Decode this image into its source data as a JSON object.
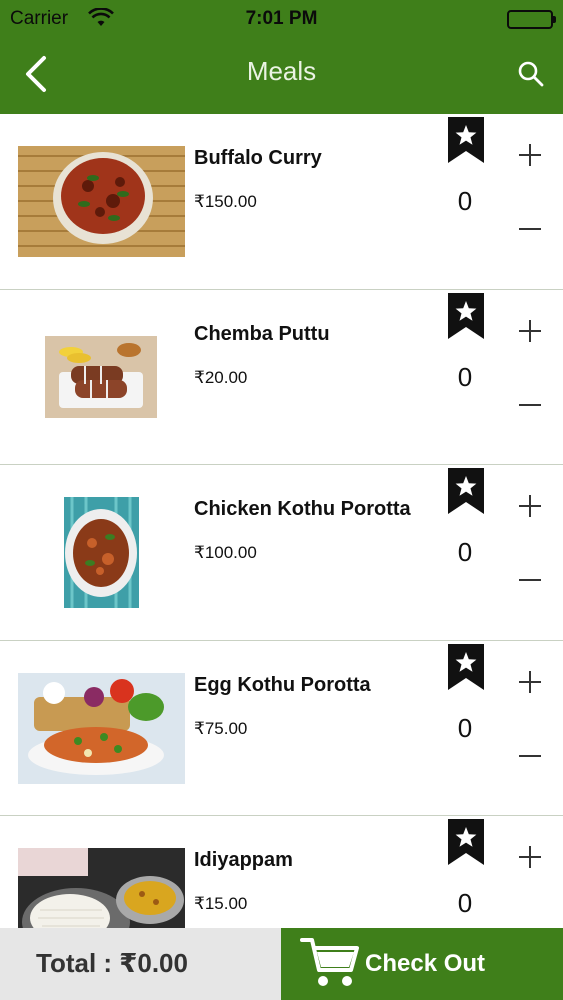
{
  "status_bar": {
    "carrier": "Carrier",
    "time": "7:01 PM"
  },
  "nav": {
    "title": "Meals",
    "back_icon": "chevron-left-icon",
    "search_icon": "search-icon"
  },
  "colors": {
    "brand_green": "#3f7f1a",
    "footer_gray": "#e6e6e6"
  },
  "items": [
    {
      "name": "Buffalo Curry",
      "price": "₹150.00",
      "qty": "0"
    },
    {
      "name": "Chemba Puttu",
      "price": "₹20.00",
      "qty": "0"
    },
    {
      "name": "Chicken Kothu Porotta",
      "price": "₹100.00",
      "qty": "0"
    },
    {
      "name": "Egg Kothu Porotta",
      "price": "₹75.00",
      "qty": "0"
    },
    {
      "name": "Idiyappam",
      "price": "₹15.00",
      "qty": "0"
    }
  ],
  "footer": {
    "total": "Total : ₹0.00",
    "checkout": "Check Out",
    "cart_icon": "shopping-cart-icon"
  }
}
